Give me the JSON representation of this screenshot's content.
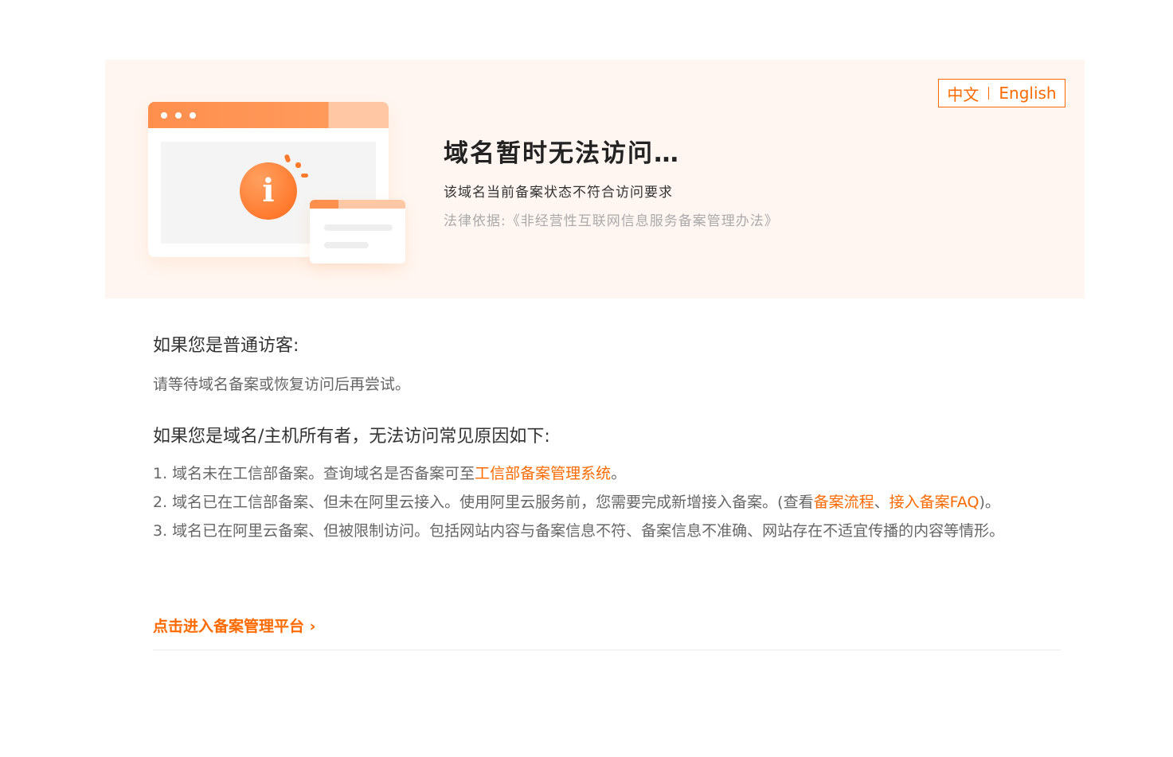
{
  "lang": {
    "zh": "中文",
    "en": "English"
  },
  "hero": {
    "title": "域名暂时无法访问…",
    "subtitle": "该域名当前备案状态不符合访问要求",
    "law": "法律依据:《非经营性互联网信息服务备案管理办法》"
  },
  "visitor": {
    "heading": "如果您是普通访客:",
    "text": "请等待域名备案或恢复访问后再尝试。"
  },
  "owner": {
    "heading": "如果您是域名/主机所有者，无法访问常见原因如下:",
    "r1_text": "1. 域名未在工信部备案。查询域名是否备案可至",
    "r1_link": "工信部备案管理系统",
    "r1_end": "。",
    "r2_text": "2. 域名已在工信部备案、但未在阿里云接入。使用阿里云服务前，您需要完成新增接入备案。(查看",
    "r2_link1": "备案流程",
    "r2_sep": "、",
    "r2_link2": "接入备案FAQ",
    "r2_end": ")。",
    "r3_text": "3. 域名已在阿里云备案、但被限制访问。包括网站内容与备案信息不符、备案信息不准确、网站存在不适宜传播的内容等情形。"
  },
  "cta": {
    "label": "点击进入备案管理平台",
    "arrow": "›"
  },
  "colors": {
    "accent": "#ff6a00",
    "banner_bg": "#fff6f1"
  },
  "icons": {
    "illustration": "info-browser-illustration"
  }
}
